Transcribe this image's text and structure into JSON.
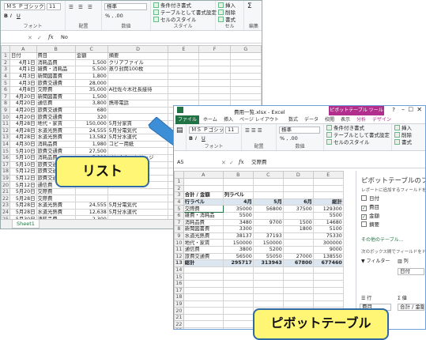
{
  "list_window": {
    "font_name": "ＭＳ Ｐゴシック",
    "font_size": "11",
    "number_format": "標準",
    "cell_ref": "",
    "formula_content": "No",
    "ribbon_groups": [
      "フォント",
      "配置",
      "数値",
      "スタイル",
      "セル",
      "編集"
    ],
    "ribbon_buttons": {
      "conditional": "条件付き書式",
      "table_format": "テーブルとして書式設定",
      "cell_style": "セルのスタイル",
      "insert": "挿入",
      "delete": "削除",
      "format": "書式"
    },
    "col_headers": [
      "A",
      "B",
      "C",
      "D",
      "E",
      "F",
      "G"
    ],
    "row_numbers": [
      "1",
      "2",
      "3",
      "4",
      "5",
      "6",
      "7",
      "8",
      "9",
      "10",
      "11",
      "12",
      "13",
      "14",
      "15",
      "16",
      "17",
      "18",
      "19",
      "20",
      "21",
      "22",
      "23",
      "24",
      "25",
      "26"
    ],
    "table_headers": [
      "日付",
      "費目",
      "金額",
      "摘要"
    ],
    "rows": [
      [
        "4月1日",
        "消耗品費",
        "1,500",
        "クリアファイル"
      ],
      [
        "4月1日",
        "雑費・消耗品",
        "5,500",
        "蒸り封筒100枚"
      ],
      [
        "4月3日",
        "新聞図書費",
        "1,800",
        ""
      ],
      [
        "4月3日",
        "旅費交通費",
        "28,000",
        ""
      ],
      [
        "4月8日",
        "交際費",
        "35,000",
        "A社佐々木社長接待"
      ],
      [
        "4月20日",
        "新聞図書費",
        "1,500",
        ""
      ],
      [
        "4月20日",
        "通信費",
        "3,800",
        "携帯電話"
      ],
      [
        "4月20日",
        "旅費交通費",
        "680",
        ""
      ],
      [
        "4月20日",
        "旅費交通費",
        "320",
        ""
      ],
      [
        "4月28日",
        "地代・家賃",
        "150,000",
        "5月分家賃"
      ],
      [
        "4月28日",
        "水道光熱費",
        "24,555",
        "5月分電気代"
      ],
      [
        "4月28日",
        "水道光熱費",
        "13,582",
        "5月分水道代"
      ],
      [
        "4月30日",
        "消耗品費",
        "1,980",
        "コピー用紙"
      ],
      [
        "5月10日",
        "旅費交通費",
        "27,500",
        ""
      ],
      [
        "5月10日",
        "消耗品費",
        "5,800",
        "インクカートリッジ"
      ],
      [
        "5月10日",
        "旅費交通費",
        "27,500",
        ""
      ],
      [
        "5月12日",
        "旅費交通費",
        "",
        ""
      ],
      [
        "5月12日",
        "旅費交通費",
        "",
        ""
      ],
      [
        "5月12日",
        "通信費",
        "",
        ""
      ],
      [
        "5月20日",
        "交際費",
        "",
        ""
      ],
      [
        "5月28日",
        "交際費",
        "",
        ""
      ],
      [
        "5月28日",
        "水道光熱費",
        "24,555",
        "5月分電気代"
      ],
      [
        "5月28日",
        "水道光熱費",
        "12,638",
        "5月分水道代"
      ],
      [
        "5月30日",
        "消耗品費",
        "2,300",
        ""
      ],
      [
        "5月31日",
        "交際費",
        "56,800",
        "旅費交通費振込"
      ]
    ],
    "sheet_tab": "Sheet1"
  },
  "pivot_window": {
    "title": "費用一覧.xlsx - Excel",
    "tool_title": "ピボットテーブル ツール",
    "tabs": [
      "ファイル",
      "ホーム",
      "挿入",
      "ページ レイアウト",
      "数式",
      "データ",
      "校閲",
      "表示",
      "分析",
      "デザイン"
    ],
    "font_name": "ＭＳ Ｐゴシック",
    "font_size": "11",
    "number_format": "標準",
    "cell_ref": "A5",
    "formula_content": "交際費",
    "ribbon_groups": [
      "フォント",
      "配置",
      "数値",
      "スタイル"
    ],
    "ribbon_buttons": {
      "conditional": "条件付き書式",
      "table_format": "テーブルとして書式設定",
      "cell_style": "セルのスタイル",
      "insert": "挿入",
      "delete": "削除",
      "format": "書式"
    },
    "col_headers": [
      "A",
      "B",
      "C",
      "D",
      "E"
    ],
    "row_numbers": [
      "1",
      "2",
      "3",
      "4",
      "5",
      "6",
      "7",
      "8",
      "9",
      "10",
      "11",
      "12",
      "13",
      "14",
      "15",
      "16",
      "17",
      "18",
      "19",
      "20",
      "21",
      "22",
      "23",
      "24"
    ],
    "pivot": {
      "corner_label": "合計 / 金額",
      "col_label": "列ラベル",
      "row_label": "行ラベル",
      "columns": [
        "4月",
        "5月",
        "6月",
        "総計"
      ],
      "rows": [
        {
          "label": "交際費",
          "values": [
            "35000",
            "56800",
            "37500",
            "129300"
          ]
        },
        {
          "label": "雑費・消耗品",
          "values": [
            "5500",
            "",
            "",
            "5500"
          ]
        },
        {
          "label": "消耗品費",
          "values": [
            "3480",
            "9700",
            "1500",
            "14680"
          ]
        },
        {
          "label": "新聞図書費",
          "values": [
            "3300",
            "",
            "1800",
            "5100"
          ]
        },
        {
          "label": "水道光熱費",
          "values": [
            "38137",
            "37193",
            "",
            "75330"
          ]
        },
        {
          "label": "地代・家賃",
          "values": [
            "150000",
            "150000",
            "",
            "300000"
          ]
        },
        {
          "label": "通信費",
          "values": [
            "3800",
            "5200",
            "",
            "9000"
          ]
        },
        {
          "label": "旅費交通費",
          "values": [
            "56500",
            "55050",
            "27000",
            "138550"
          ]
        }
      ],
      "total_label": "総計",
      "totals": [
        "295717",
        "313943",
        "67800",
        "677460"
      ]
    },
    "field_pane": {
      "title": "ピボットテーブルのフィー",
      "description": "レポートに追加するフィールドを選択して",
      "fields": [
        {
          "name": "日付",
          "checked": false
        },
        {
          "name": "費目",
          "checked": true
        },
        {
          "name": "金額",
          "checked": true
        },
        {
          "name": "摘要",
          "checked": false
        }
      ],
      "more_tables": "その他のテーブル...",
      "area_hint": "次のボックス間でフィールドをドラッグして",
      "filter_label": "フィルター",
      "columns_label": "列",
      "columns_value": "日付",
      "rows_label": "行",
      "rows_value": "費目",
      "values_label": "値",
      "values_value": "合計 / 金額"
    }
  },
  "callouts": {
    "list": "リスト",
    "pivot": "ピボットテーブル"
  },
  "colors": {
    "excel_green": "#217346",
    "callout_fill": "#fff676",
    "callout_border": "#2f6aa3",
    "arrow": "#3c8fd6"
  },
  "icons": [
    "cancel-icon",
    "enter-icon",
    "function-icon",
    "dropdown-icon",
    "close-icon",
    "minimize-icon",
    "maximize-icon",
    "help-icon"
  ]
}
